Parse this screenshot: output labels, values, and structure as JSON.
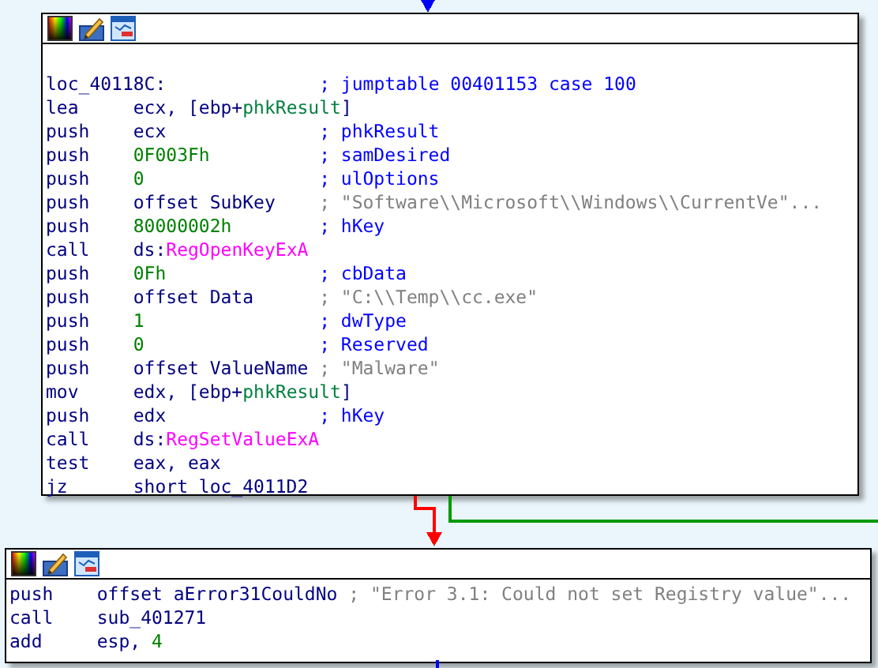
{
  "edges": [
    {
      "kind": "incoming"
    },
    {
      "kind": "false"
    },
    {
      "kind": "true"
    },
    {
      "kind": "outgoing"
    }
  ],
  "blocks": [
    {
      "lines": [
        {
          "kind": "label",
          "label": "loc_40118C:",
          "comment": {
            "text": "; jumptable 00401153 case 100",
            "kind": "name"
          }
        },
        {
          "kind": "instr",
          "mnemonic": "lea",
          "operands": [
            {
              "text": "ecx, [ebp+",
              "kind": "plain"
            },
            {
              "text": "phkResult",
              "kind": "var"
            },
            {
              "text": "]",
              "kind": "plain"
            }
          ]
        },
        {
          "kind": "instr",
          "mnemonic": "push",
          "operands": [
            {
              "text": "ecx",
              "kind": "plain"
            }
          ],
          "comment": {
            "text": "; phkResult",
            "kind": "name"
          }
        },
        {
          "kind": "instr",
          "mnemonic": "push",
          "operands": [
            {
              "text": "0F003Fh",
              "kind": "number"
            }
          ],
          "comment": {
            "text": "; samDesired",
            "kind": "name"
          }
        },
        {
          "kind": "instr",
          "mnemonic": "push",
          "operands": [
            {
              "text": "0",
              "kind": "number"
            }
          ],
          "comment": {
            "text": "; ulOptions",
            "kind": "name"
          }
        },
        {
          "kind": "instr",
          "mnemonic": "push",
          "operands": [
            {
              "text": "offset SubKey",
              "kind": "plain"
            }
          ],
          "comment": {
            "text": "; \"Software\\\\Microsoft\\\\Windows\\\\CurrentVe\"...",
            "kind": "string"
          }
        },
        {
          "kind": "instr",
          "mnemonic": "push",
          "operands": [
            {
              "text": "80000002h",
              "kind": "number"
            }
          ],
          "comment": {
            "text": "; hKey",
            "kind": "name"
          }
        },
        {
          "kind": "instr",
          "mnemonic": "call",
          "operands": [
            {
              "text": "ds:",
              "kind": "plain"
            },
            {
              "text": "RegOpenKeyExA",
              "kind": "import"
            }
          ]
        },
        {
          "kind": "instr",
          "mnemonic": "push",
          "operands": [
            {
              "text": "0Fh",
              "kind": "number"
            }
          ],
          "comment": {
            "text": "; cbData",
            "kind": "name"
          }
        },
        {
          "kind": "instr",
          "mnemonic": "push",
          "operands": [
            {
              "text": "offset Data",
              "kind": "plain"
            }
          ],
          "comment": {
            "text": "; \"C:\\\\Temp\\\\cc.exe\"",
            "kind": "string"
          }
        },
        {
          "kind": "instr",
          "mnemonic": "push",
          "operands": [
            {
              "text": "1",
              "kind": "number"
            }
          ],
          "comment": {
            "text": "; dwType",
            "kind": "name"
          }
        },
        {
          "kind": "instr",
          "mnemonic": "push",
          "operands": [
            {
              "text": "0",
              "kind": "number"
            }
          ],
          "comment": {
            "text": "; Reserved",
            "kind": "name"
          }
        },
        {
          "kind": "instr",
          "mnemonic": "push",
          "operands": [
            {
              "text": "offset ValueName",
              "kind": "plain"
            }
          ],
          "comment": {
            "text": "; \"Malware\"",
            "kind": "string"
          }
        },
        {
          "kind": "instr",
          "mnemonic": "mov",
          "operands": [
            {
              "text": "edx, [ebp+",
              "kind": "plain"
            },
            {
              "text": "phkResult",
              "kind": "var"
            },
            {
              "text": "]",
              "kind": "plain"
            }
          ]
        },
        {
          "kind": "instr",
          "mnemonic": "push",
          "operands": [
            {
              "text": "edx",
              "kind": "plain"
            }
          ],
          "comment": {
            "text": "; hKey",
            "kind": "name"
          }
        },
        {
          "kind": "instr",
          "mnemonic": "call",
          "operands": [
            {
              "text": "ds:",
              "kind": "plain"
            },
            {
              "text": "RegSetValueExA",
              "kind": "import"
            }
          ]
        },
        {
          "kind": "instr",
          "mnemonic": "test",
          "operands": [
            {
              "text": "eax, eax",
              "kind": "plain"
            }
          ]
        },
        {
          "kind": "instr",
          "mnemonic": "jz",
          "operands": [
            {
              "text": "short loc_4011D2",
              "kind": "plain"
            }
          ]
        }
      ]
    },
    {
      "lines": [
        {
          "kind": "instr",
          "mnemonic": "push",
          "operands": [
            {
              "text": "offset aError31CouldNo",
              "kind": "plain"
            }
          ],
          "comment": {
            "text": "; \"Error 3.1: Could not set Registry value\"...",
            "kind": "string"
          }
        },
        {
          "kind": "instr",
          "mnemonic": "call",
          "operands": [
            {
              "text": "sub_401271",
              "kind": "plain"
            }
          ]
        },
        {
          "kind": "instr",
          "mnemonic": "add",
          "operands": [
            {
              "text": "esp, ",
              "kind": "plain"
            },
            {
              "text": "4",
              "kind": "number"
            }
          ]
        }
      ]
    }
  ]
}
